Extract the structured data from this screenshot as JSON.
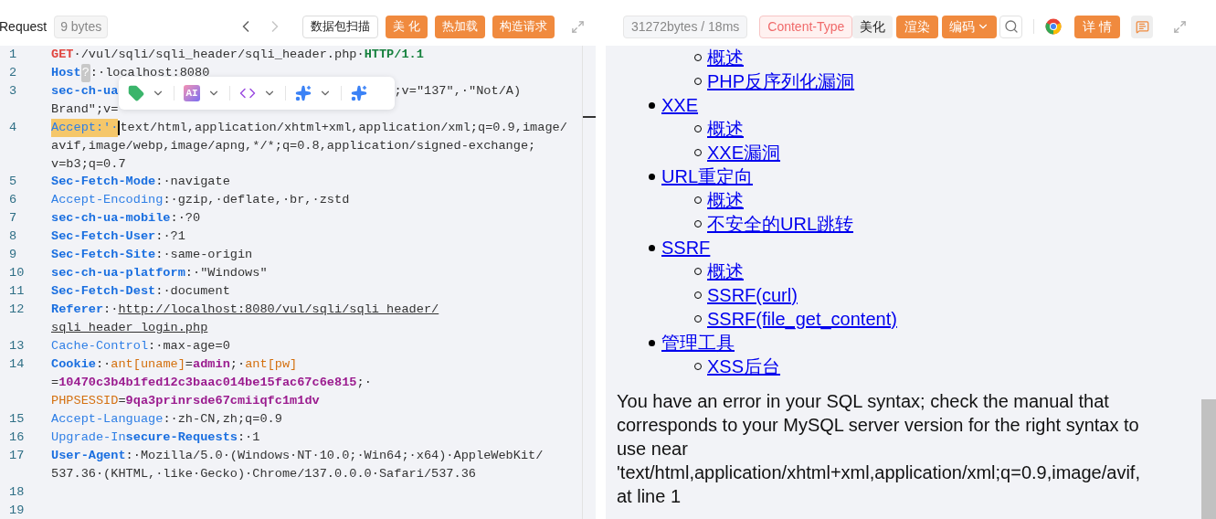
{
  "request_panel": {
    "title": "Request",
    "size": "9 bytes",
    "nav": [
      {
        "kind": "prev",
        "disabled": false
      },
      {
        "kind": "next",
        "disabled": true
      }
    ],
    "buttons": [
      {
        "label": "数据包扫描",
        "kind": "outline"
      },
      {
        "label": "美 化",
        "kind": "primary"
      },
      {
        "label": "热加载",
        "kind": "primary"
      },
      {
        "label": "构造请求",
        "kind": "primary"
      }
    ],
    "lines": [
      {
        "number": "1",
        "rows": [
          [
            {
              "kind": "method",
              "text": "GET"
            },
            {
              "kind": "text",
              "text": "·/vul/sqli/sqli_header/sqli_header.php·"
            },
            {
              "kind": "version",
              "text": "HTTP/1.1"
            }
          ]
        ]
      },
      {
        "number": "2",
        "rows": [
          [
            {
              "kind": "key",
              "text": "Host"
            },
            {
              "kind": "badge",
              "text": "?"
            },
            {
              "kind": "text",
              "text": ":·localhost:8080"
            }
          ]
        ]
      },
      {
        "number": "3",
        "rows": [
          [
            {
              "kind": "key",
              "text": "sec-ch-ua"
            },
            {
              "kind": "gap"
            },
            {
              "kind": "text",
              "text": ";v=\"137\",·\"Not/A)"
            }
          ],
          [
            {
              "kind": "text",
              "text": "Brand\";v="
            }
          ]
        ]
      },
      {
        "number": "4",
        "rows": [
          [
            {
              "kind": "highlight",
              "text": "Accept:'·"
            },
            {
              "kind": "cursor"
            },
            {
              "kind": "text",
              "text": "text/html,application/xhtml+xml,application/xml;q=0.9,image/"
            }
          ],
          [
            {
              "kind": "text",
              "text": "avif,image/webp,image/apng,*/*;q=0.8,application/signed-exchange;"
            }
          ],
          [
            {
              "kind": "text",
              "text": "v=b3;q=0.7"
            }
          ]
        ]
      },
      {
        "number": "5",
        "rows": [
          [
            {
              "kind": "key",
              "text": "Sec-Fetch-Mode"
            },
            {
              "kind": "text",
              "text": ":·navigate"
            }
          ]
        ]
      },
      {
        "number": "6",
        "rows": [
          [
            {
              "kind": "key_light",
              "text": "Accept-Encoding"
            },
            {
              "kind": "text",
              "text": ":·gzip,·deflate,·br,·zstd"
            }
          ]
        ]
      },
      {
        "number": "7",
        "rows": [
          [
            {
              "kind": "key",
              "text": "sec-ch-ua-mobile"
            },
            {
              "kind": "text",
              "text": ":·?0"
            }
          ]
        ]
      },
      {
        "number": "8",
        "rows": [
          [
            {
              "kind": "key",
              "text": "Sec-Fetch-User"
            },
            {
              "kind": "text",
              "text": ":·?1"
            }
          ]
        ]
      },
      {
        "number": "9",
        "rows": [
          [
            {
              "kind": "key",
              "text": "Sec-Fetch-Site"
            },
            {
              "kind": "text",
              "text": ":·same-origin"
            }
          ]
        ]
      },
      {
        "number": "10",
        "rows": [
          [
            {
              "kind": "key",
              "text": "sec-ch-ua-platform"
            },
            {
              "kind": "text",
              "text": ":·\"Windows\""
            }
          ]
        ]
      },
      {
        "number": "11",
        "rows": [
          [
            {
              "kind": "key",
              "text": "Sec-Fetch-Dest"
            },
            {
              "kind": "text",
              "text": ":·document"
            }
          ]
        ]
      },
      {
        "number": "12",
        "rows": [
          [
            {
              "kind": "key",
              "text": "Referer"
            },
            {
              "kind": "text",
              "text": ":·"
            },
            {
              "kind": "link",
              "text": "http://localhost:8080/vul/sqli/sqli_header/"
            }
          ],
          [
            {
              "kind": "link",
              "text": "sqli_header_login.php"
            }
          ]
        ]
      },
      {
        "number": "13",
        "rows": [
          [
            {
              "kind": "key_light",
              "text": "Cache-Control"
            },
            {
              "kind": "text",
              "text": ":·max-age=0"
            }
          ]
        ]
      },
      {
        "number": "14",
        "rows": [
          [
            {
              "kind": "key",
              "text": "Cookie"
            },
            {
              "kind": "text",
              "text": ":·"
            },
            {
              "kind": "cookie_name",
              "text": "ant[uname]"
            },
            {
              "kind": "text",
              "text": "="
            },
            {
              "kind": "cookie_value",
              "text": "admin"
            },
            {
              "kind": "text",
              "text": ";·"
            },
            {
              "kind": "cookie_name",
              "text": "ant[pw]"
            }
          ],
          [
            {
              "kind": "text",
              "text": "="
            },
            {
              "kind": "cookie_value",
              "text": "10470c3b4b1fed12c3baac014be15fac67c6e815"
            },
            {
              "kind": "text",
              "text": ";·"
            }
          ],
          [
            {
              "kind": "cookie_name",
              "text": "PHPSESSID"
            },
            {
              "kind": "text",
              "text": "="
            },
            {
              "kind": "cookie_value",
              "text": "9qa3prinrsde67cmiiqfc1m1dv"
            }
          ]
        ]
      },
      {
        "number": "15",
        "rows": [
          [
            {
              "kind": "key_light",
              "text": "Accept-Language"
            },
            {
              "kind": "text",
              "text": ":·zh-CN,zh;q=0.9"
            }
          ]
        ]
      },
      {
        "number": "16",
        "rows": [
          [
            {
              "kind": "key_light",
              "text": "Upgrade-In"
            },
            {
              "kind": "key",
              "text": "secure-Requests"
            },
            {
              "kind": "text",
              "text": ":·1"
            }
          ]
        ]
      },
      {
        "number": "17",
        "rows": [
          [
            {
              "kind": "key",
              "text": "User-Agent"
            },
            {
              "kind": "text",
              "text": ":·Mozilla/5.0·(Windows·NT·10.0;·Win64;·x64)·AppleWebKit/"
            }
          ],
          [
            {
              "kind": "text",
              "text": "537.36·(KHTML,·like·Gecko)·Chrome/137.0.0.0·Safari/537.36"
            }
          ]
        ]
      },
      {
        "number": "18",
        "rows": [
          []
        ]
      },
      {
        "number": "19",
        "rows": [
          []
        ]
      }
    ],
    "floating_toolbar": [
      {
        "kind": "tag",
        "menu": true
      },
      {
        "kind": "ai",
        "label": "AI",
        "menu": true
      },
      {
        "kind": "code",
        "menu": true
      },
      {
        "kind": "sparkle",
        "menu": true
      },
      {
        "kind": "sparkle",
        "menu": false
      }
    ]
  },
  "response_panel": {
    "stats": "31272bytes / 18ms",
    "tools": [
      {
        "kind": "tag",
        "label": "Content-Type"
      },
      {
        "kind": "plain",
        "label": "美化"
      },
      {
        "kind": "primary",
        "label": "渲染"
      },
      {
        "kind": "dropdown",
        "label": "编码"
      },
      {
        "kind": "search"
      },
      {
        "kind": "browser"
      },
      {
        "kind": "primary",
        "label": "详 情"
      },
      {
        "kind": "comment"
      },
      {
        "kind": "expand"
      }
    ],
    "list": [
      {
        "children": [
          "概述",
          "PHP反序列化漏洞"
        ]
      },
      {
        "label": "XXE",
        "children": [
          "概述",
          "XXE漏洞"
        ]
      },
      {
        "label": "URL重定向",
        "children": [
          "概述",
          "不安全的URL跳转"
        ]
      },
      {
        "label": "SSRF",
        "children": [
          "概述",
          "SSRF(curl)",
          "SSRF(file_get_content)"
        ]
      },
      {
        "label": "管理工具",
        "children": [
          "XSS后台"
        ]
      }
    ],
    "error": [
      "You have an error in your SQL syntax; check the manual that",
      "corresponds to your MySQL server version for the right syntax to",
      "use near",
      "'text/html,application/xhtml+xml,application/xml;q=0.9,image/avif,",
      "at line 1"
    ]
  }
}
